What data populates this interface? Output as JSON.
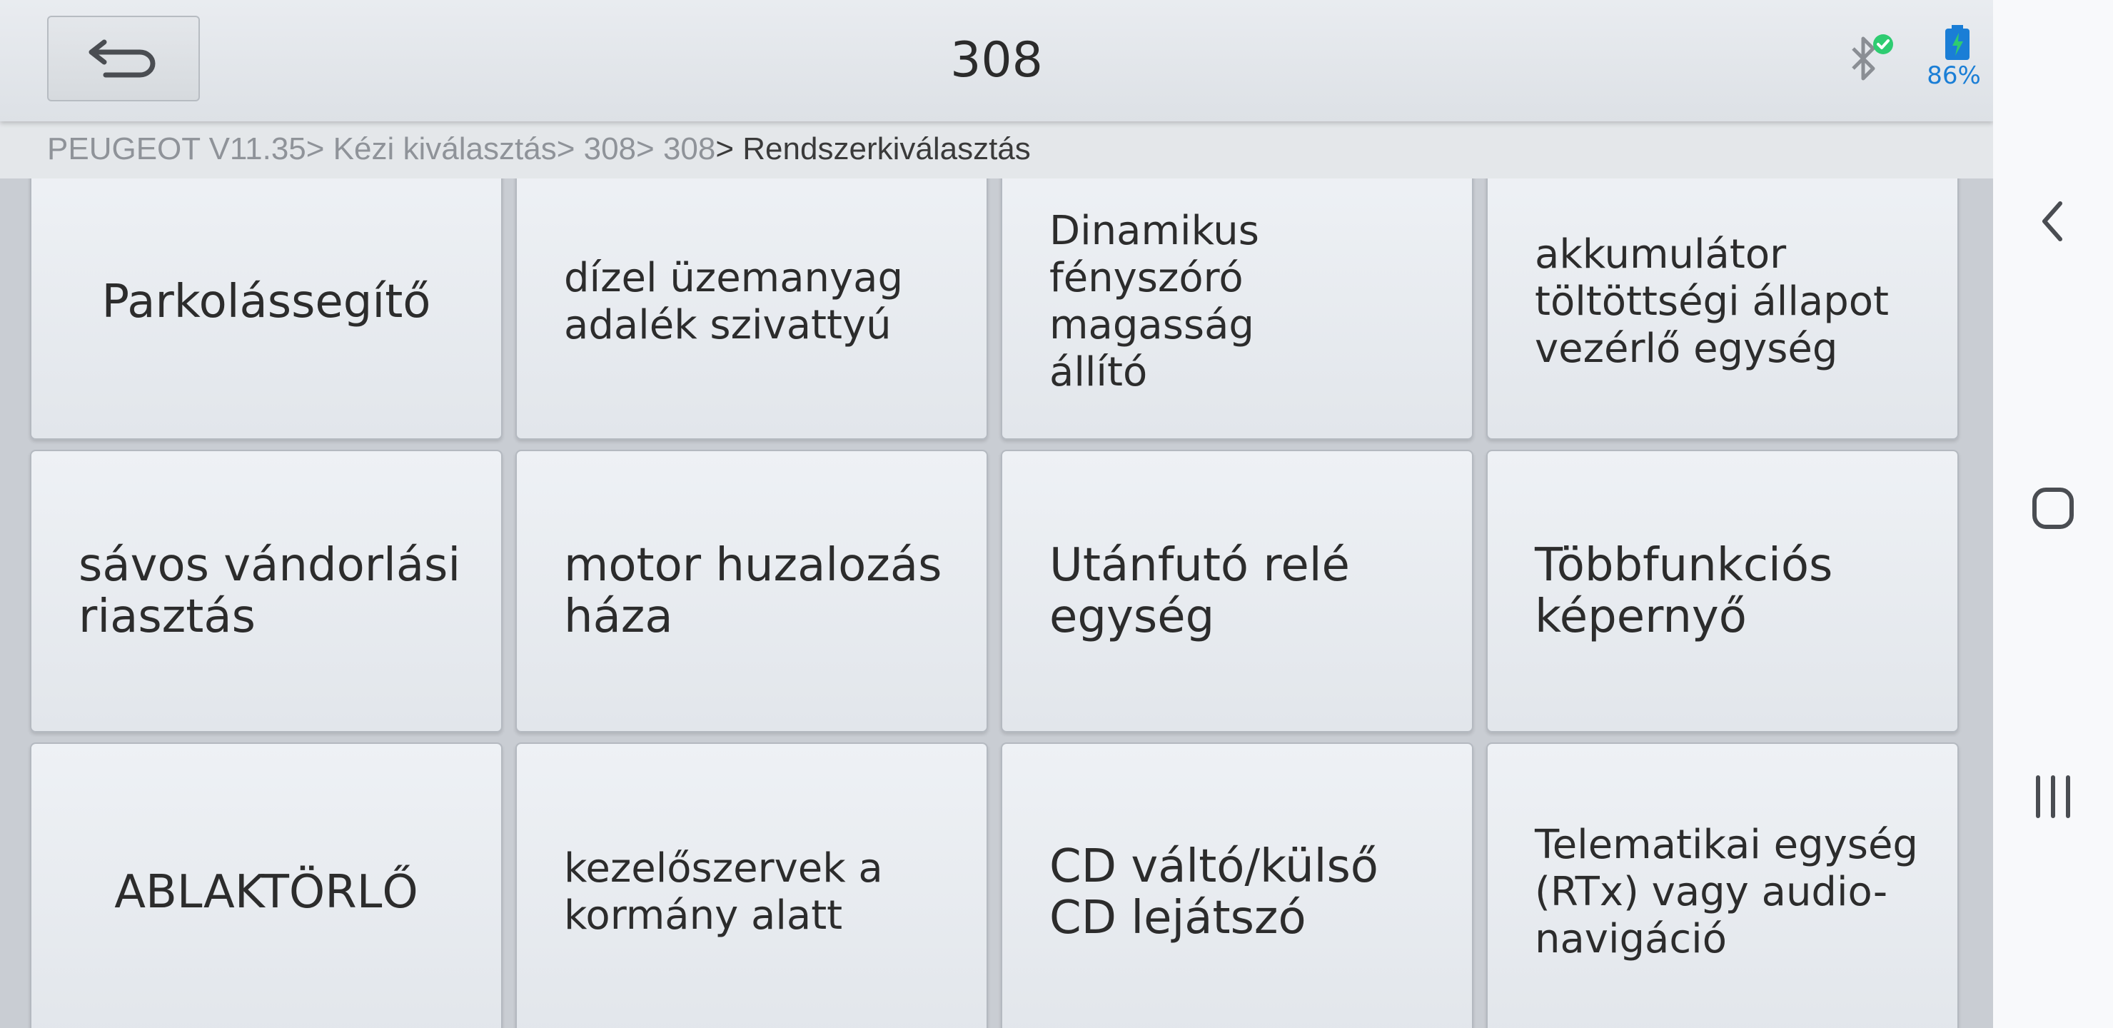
{
  "header": {
    "title": "308",
    "battery_percent": "86%",
    "back_icon": "back-arrow-icon",
    "bluetooth_icon": "bluetooth-connected-icon",
    "battery_icon": "battery-charging-icon"
  },
  "breadcrumb": {
    "path": "PEUGEOT V11.35> Kézi kiválasztás> 308> 308",
    "current": "> Rendszerkiválasztás"
  },
  "tiles": [
    {
      "label": "Parkolássegítő"
    },
    {
      "label": "dízel üzemanyag\nadalék szivattyú"
    },
    {
      "label": "Dinamikus\nfényszóró magasság\nállító"
    },
    {
      "label": "akkumulátor\ntöltöttségi állapot\nvezérlő egység"
    },
    {
      "label": "sávos vándorlási\nriasztás"
    },
    {
      "label": "motor huzalozás\nháza"
    },
    {
      "label": "Utánfutó relé\negység"
    },
    {
      "label": "Többfunkciós\nképernyő"
    },
    {
      "label": "ABLAKTÖRLŐ"
    },
    {
      "label": "kezelőszervek a\nkormány alatt"
    },
    {
      "label": "CD váltó/külső\nCD lejátszó"
    },
    {
      "label": "Telematikai egység\n(RTx) vagy audio-\nnavigáció"
    }
  ],
  "system_nav": {
    "back_icon": "nav-back-icon",
    "home_icon": "nav-home-icon",
    "recents_icon": "nav-recents-icon"
  },
  "colors": {
    "accent_blue": "#1a7ed6",
    "status_green": "#2ecc71"
  }
}
